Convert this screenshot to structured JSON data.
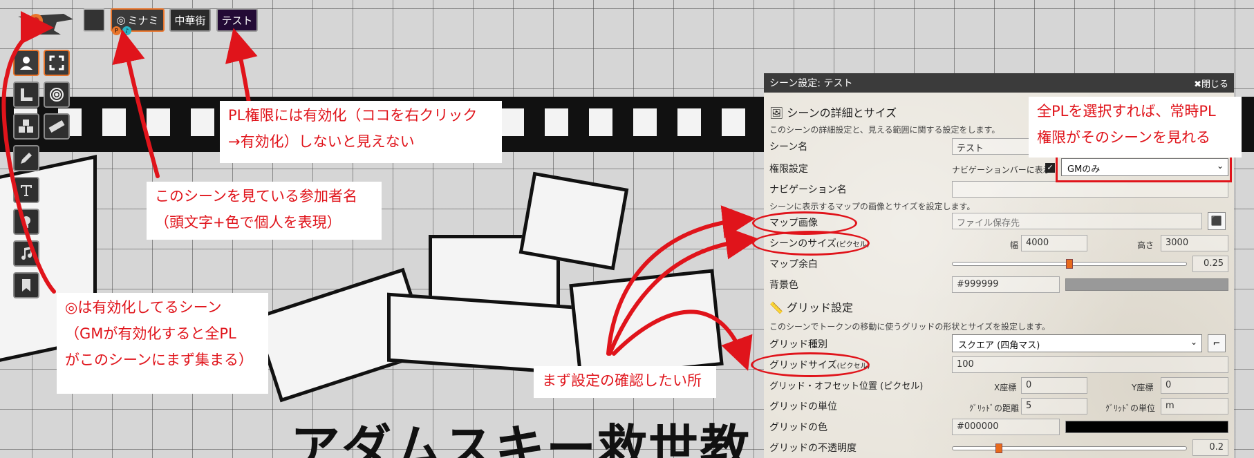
{
  "topbar": {
    "tabs": [
      {
        "label": ""
      },
      {
        "label": "ミナミ",
        "active_marker": "◎",
        "participants": [
          {
            "initial": "P",
            "color": "#e8742b"
          },
          {
            "initial": "♪",
            "color": "#2bb5c6"
          }
        ]
      },
      {
        "label": "中華街"
      },
      {
        "label": "テスト"
      }
    ]
  },
  "toolbar": {
    "icons": [
      "person-icon",
      "fullscreen-icon",
      "ruler-corner-icon",
      "target-icon",
      "dice-icon",
      "ruler-icon",
      "pencil-icon",
      "text-icon",
      "lightbulb-icon",
      "music-icon",
      "bookmark-icon"
    ]
  },
  "map": {
    "title": "アダムスキー救世教"
  },
  "dialog": {
    "title": "シーン設定: テスト",
    "close_label": "✖閉じる",
    "section1": {
      "heading": "シーンの詳細とサイズ",
      "description": "このシーンの詳細設定と、見える範囲に関する設定をします。",
      "scene_name_label": "シーン名",
      "scene_name_value": "テスト",
      "permission_label": "権限設定",
      "navbar_show_label": "ナビゲーションバーに表示",
      "permission_value": "GMのみ",
      "nav_name_label": "ナビゲーション名",
      "nav_name_value": "",
      "map_description": "シーンに表示するマップの画像とサイズを設定します。",
      "map_image_label": "マップ画像",
      "map_image_placeholder": "ファイル保存先",
      "scene_size_label": "シーンのサイズ",
      "scene_size_unit": "(ピクセル)",
      "width_label": "幅",
      "width_value": "4000",
      "height_label": "高さ",
      "height_value": "3000",
      "margin_label": "マップ余白",
      "margin_value": "0.25",
      "margin_fraction": 0.5,
      "bgcolor_label": "背景色",
      "bgcolor_value": "#999999"
    },
    "section2": {
      "heading": "グリッド設定",
      "description": "このシーンでトークンの移動に使うグリッドの形状とサイズを設定します。",
      "grid_type_label": "グリッド種別",
      "grid_type_value": "スクエア (四角マス)",
      "grid_size_label": "グリッドサイズ",
      "grid_size_unit": "(ピクセル)",
      "grid_size_value": "100",
      "offset_label": "グリッド・オフセット位置 (ピクセル)",
      "x_label": "X座標",
      "x_value": "0",
      "y_label": "Y座標",
      "y_value": "0",
      "unit_label": "グリッドの単位",
      "distance_label": "ｸﾞﾘｯﾄﾞの距離",
      "distance_value": "5",
      "grid_unit_label": "ｸﾞﾘｯﾄﾞの単位",
      "grid_unit_value": "m",
      "color_label": "グリッドの色",
      "color_value": "#000000",
      "opacity_label": "グリッドの不透明度",
      "opacity_value": "0.2",
      "opacity_fraction": 0.2
    }
  },
  "annotations": {
    "pl_permission": "PL権限には有効化（ココを右クリック\n→有効化）しないと見えない",
    "participants": "このシーンを見ている参加者名\n（頭文字+色で個人を表現）",
    "active_scene": "◎は有効化してるシーン\n（GMが有効化すると全PL\nがこのシーンにまず集まる）",
    "select_all_pl": "全PLを選択すれば、常時PL\n権限がそのシーンを見れる",
    "check_first": "まず設定の確認したい所"
  },
  "colors": {
    "annotation_red": "#e0141b",
    "active_orange": "#e8742b"
  }
}
